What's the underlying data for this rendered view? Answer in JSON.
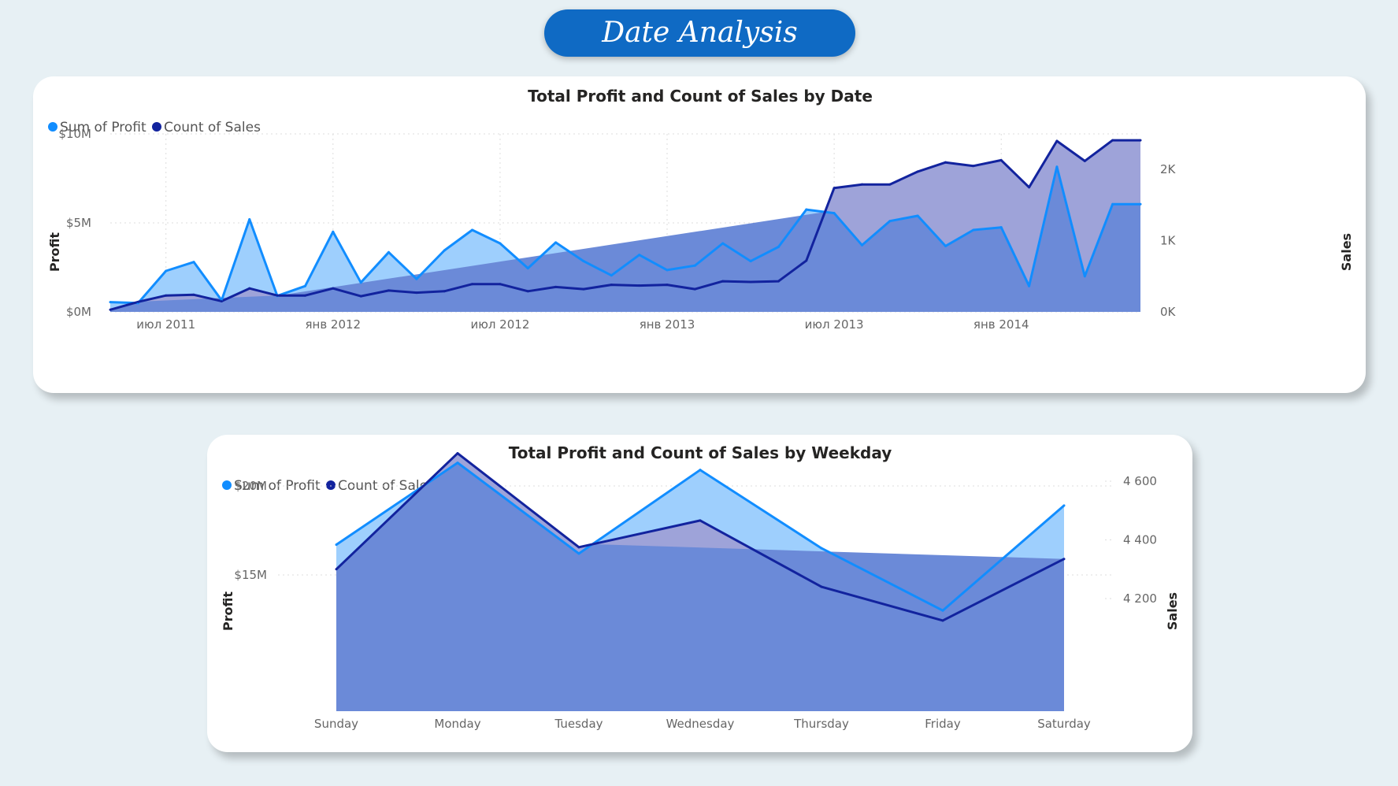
{
  "page": {
    "title": "Date Analysis"
  },
  "colors": {
    "profit_line": "#118dff",
    "profit_fill": "#9ecffd",
    "sales_line": "#12239e",
    "overlap_fill": "#6b8ad8",
    "sales_only_fill": "#9ea3d9",
    "grid": "#dddddd"
  },
  "chart_data": [
    {
      "type": "area",
      "title": "Total Profit and Count of Sales by Date",
      "legend": [
        "Sum of Profit",
        "Count of Sales"
      ],
      "legend_position": "top-left",
      "xlabel": "",
      "ylabel": "Profit",
      "y2label": "Sales",
      "x": [
        "2011-05",
        "2011-06",
        "2011-07",
        "2011-08",
        "2011-09",
        "2011-10",
        "2011-11",
        "2011-12",
        "2012-01",
        "2012-02",
        "2012-03",
        "2012-04",
        "2012-05",
        "2012-06",
        "2012-07",
        "2012-08",
        "2012-09",
        "2012-10",
        "2012-11",
        "2012-12",
        "2013-01",
        "2013-02",
        "2013-03",
        "2013-04",
        "2013-05",
        "2013-06",
        "2013-07",
        "2013-08",
        "2013-09",
        "2013-10",
        "2013-11",
        "2013-12",
        "2014-01",
        "2014-02",
        "2014-03",
        "2014-04",
        "2014-05",
        "2014-06"
      ],
      "x_ticks": [
        "июл 2011",
        "янв 2012",
        "июл 2012",
        "янв 2013",
        "июл 2013",
        "янв 2014"
      ],
      "y_ticks": [
        "$0M",
        "$5M",
        "$10M"
      ],
      "y2_ticks": [
        "0K",
        "1K",
        "2K"
      ],
      "ylim": [
        0,
        10
      ],
      "y2lim": [
        0,
        2.5
      ],
      "series": [
        {
          "name": "Sum of Profit",
          "axis": "left",
          "unit": "$M",
          "values": [
            0.55,
            0.5,
            2.3,
            2.8,
            0.65,
            5.2,
            0.9,
            1.45,
            4.5,
            1.65,
            3.35,
            1.85,
            3.45,
            4.6,
            3.85,
            2.45,
            3.9,
            2.85,
            2.05,
            3.2,
            2.35,
            2.6,
            3.85,
            2.85,
            3.65,
            5.75,
            5.55,
            3.75,
            5.1,
            5.4,
            3.7,
            4.6,
            4.75,
            1.45,
            8.15,
            2.0,
            6.05,
            6.05
          ]
        },
        {
          "name": "Count of Sales",
          "axis": "right",
          "unit": "K",
          "values": [
            0.03,
            0.14,
            0.23,
            0.24,
            0.15,
            0.33,
            0.23,
            0.23,
            0.33,
            0.22,
            0.3,
            0.27,
            0.29,
            0.39,
            0.39,
            0.29,
            0.35,
            0.32,
            0.38,
            0.37,
            0.38,
            0.32,
            0.43,
            0.42,
            0.43,
            0.72,
            1.74,
            1.79,
            1.79,
            1.97,
            2.1,
            2.05,
            2.13,
            1.75,
            2.4,
            2.12,
            2.41,
            2.41
          ]
        }
      ]
    },
    {
      "type": "area",
      "title": "Total Profit and Count of Sales by Weekday",
      "legend": [
        "Sum of Profit",
        "Count of Sales"
      ],
      "legend_position": "top-left",
      "xlabel": "",
      "ylabel": "Profit",
      "y2label": "Sales",
      "categories": [
        "Sunday",
        "Monday",
        "Tuesday",
        "Wednesday",
        "Thursday",
        "Friday",
        "Saturday"
      ],
      "y_ticks": [
        "$15M",
        "$20M"
      ],
      "y2_ticks": [
        "4 200",
        "4 400",
        "4 600"
      ],
      "series": [
        {
          "name": "Sum of Profit",
          "axis": "left",
          "unit": "$M",
          "values": [
            16.7,
            21.3,
            16.2,
            20.9,
            16.5,
            13.0,
            18.9
          ]
        },
        {
          "name": "Count of Sales",
          "axis": "right",
          "values": [
            4300,
            4695,
            4375,
            4466,
            4240,
            4125,
            4335
          ]
        }
      ]
    }
  ]
}
